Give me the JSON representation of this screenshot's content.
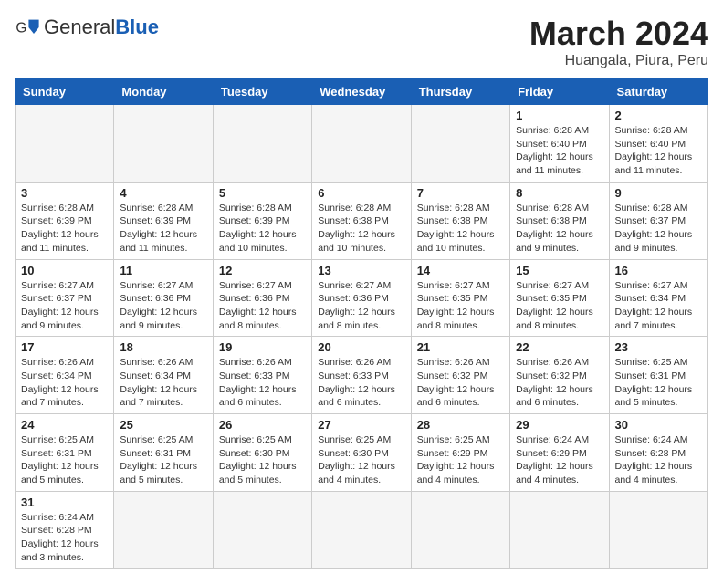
{
  "header": {
    "logo_general": "General",
    "logo_blue": "Blue",
    "title": "March 2024",
    "subtitle": "Huangala, Piura, Peru"
  },
  "weekdays": [
    "Sunday",
    "Monday",
    "Tuesday",
    "Wednesday",
    "Thursday",
    "Friday",
    "Saturday"
  ],
  "weeks": [
    [
      {
        "day": "",
        "info": ""
      },
      {
        "day": "",
        "info": ""
      },
      {
        "day": "",
        "info": ""
      },
      {
        "day": "",
        "info": ""
      },
      {
        "day": "",
        "info": ""
      },
      {
        "day": "1",
        "info": "Sunrise: 6:28 AM\nSunset: 6:40 PM\nDaylight: 12 hours and 11 minutes."
      },
      {
        "day": "2",
        "info": "Sunrise: 6:28 AM\nSunset: 6:40 PM\nDaylight: 12 hours and 11 minutes."
      }
    ],
    [
      {
        "day": "3",
        "info": "Sunrise: 6:28 AM\nSunset: 6:39 PM\nDaylight: 12 hours and 11 minutes."
      },
      {
        "day": "4",
        "info": "Sunrise: 6:28 AM\nSunset: 6:39 PM\nDaylight: 12 hours and 11 minutes."
      },
      {
        "day": "5",
        "info": "Sunrise: 6:28 AM\nSunset: 6:39 PM\nDaylight: 12 hours and 10 minutes."
      },
      {
        "day": "6",
        "info": "Sunrise: 6:28 AM\nSunset: 6:38 PM\nDaylight: 12 hours and 10 minutes."
      },
      {
        "day": "7",
        "info": "Sunrise: 6:28 AM\nSunset: 6:38 PM\nDaylight: 12 hours and 10 minutes."
      },
      {
        "day": "8",
        "info": "Sunrise: 6:28 AM\nSunset: 6:38 PM\nDaylight: 12 hours and 9 minutes."
      },
      {
        "day": "9",
        "info": "Sunrise: 6:28 AM\nSunset: 6:37 PM\nDaylight: 12 hours and 9 minutes."
      }
    ],
    [
      {
        "day": "10",
        "info": "Sunrise: 6:27 AM\nSunset: 6:37 PM\nDaylight: 12 hours and 9 minutes."
      },
      {
        "day": "11",
        "info": "Sunrise: 6:27 AM\nSunset: 6:36 PM\nDaylight: 12 hours and 9 minutes."
      },
      {
        "day": "12",
        "info": "Sunrise: 6:27 AM\nSunset: 6:36 PM\nDaylight: 12 hours and 8 minutes."
      },
      {
        "day": "13",
        "info": "Sunrise: 6:27 AM\nSunset: 6:36 PM\nDaylight: 12 hours and 8 minutes."
      },
      {
        "day": "14",
        "info": "Sunrise: 6:27 AM\nSunset: 6:35 PM\nDaylight: 12 hours and 8 minutes."
      },
      {
        "day": "15",
        "info": "Sunrise: 6:27 AM\nSunset: 6:35 PM\nDaylight: 12 hours and 8 minutes."
      },
      {
        "day": "16",
        "info": "Sunrise: 6:27 AM\nSunset: 6:34 PM\nDaylight: 12 hours and 7 minutes."
      }
    ],
    [
      {
        "day": "17",
        "info": "Sunrise: 6:26 AM\nSunset: 6:34 PM\nDaylight: 12 hours and 7 minutes."
      },
      {
        "day": "18",
        "info": "Sunrise: 6:26 AM\nSunset: 6:34 PM\nDaylight: 12 hours and 7 minutes."
      },
      {
        "day": "19",
        "info": "Sunrise: 6:26 AM\nSunset: 6:33 PM\nDaylight: 12 hours and 6 minutes."
      },
      {
        "day": "20",
        "info": "Sunrise: 6:26 AM\nSunset: 6:33 PM\nDaylight: 12 hours and 6 minutes."
      },
      {
        "day": "21",
        "info": "Sunrise: 6:26 AM\nSunset: 6:32 PM\nDaylight: 12 hours and 6 minutes."
      },
      {
        "day": "22",
        "info": "Sunrise: 6:26 AM\nSunset: 6:32 PM\nDaylight: 12 hours and 6 minutes."
      },
      {
        "day": "23",
        "info": "Sunrise: 6:25 AM\nSunset: 6:31 PM\nDaylight: 12 hours and 5 minutes."
      }
    ],
    [
      {
        "day": "24",
        "info": "Sunrise: 6:25 AM\nSunset: 6:31 PM\nDaylight: 12 hours and 5 minutes."
      },
      {
        "day": "25",
        "info": "Sunrise: 6:25 AM\nSunset: 6:31 PM\nDaylight: 12 hours and 5 minutes."
      },
      {
        "day": "26",
        "info": "Sunrise: 6:25 AM\nSunset: 6:30 PM\nDaylight: 12 hours and 5 minutes."
      },
      {
        "day": "27",
        "info": "Sunrise: 6:25 AM\nSunset: 6:30 PM\nDaylight: 12 hours and 4 minutes."
      },
      {
        "day": "28",
        "info": "Sunrise: 6:25 AM\nSunset: 6:29 PM\nDaylight: 12 hours and 4 minutes."
      },
      {
        "day": "29",
        "info": "Sunrise: 6:24 AM\nSunset: 6:29 PM\nDaylight: 12 hours and 4 minutes."
      },
      {
        "day": "30",
        "info": "Sunrise: 6:24 AM\nSunset: 6:28 PM\nDaylight: 12 hours and 4 minutes."
      }
    ],
    [
      {
        "day": "31",
        "info": "Sunrise: 6:24 AM\nSunset: 6:28 PM\nDaylight: 12 hours and 3 minutes."
      },
      {
        "day": "",
        "info": ""
      },
      {
        "day": "",
        "info": ""
      },
      {
        "day": "",
        "info": ""
      },
      {
        "day": "",
        "info": ""
      },
      {
        "day": "",
        "info": ""
      },
      {
        "day": "",
        "info": ""
      }
    ]
  ]
}
